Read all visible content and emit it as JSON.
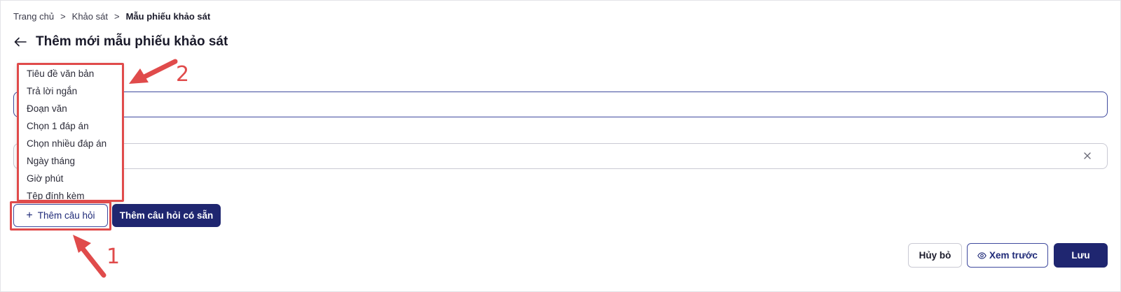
{
  "breadcrumb": {
    "items": [
      "Trang chủ",
      "Khảo sát",
      "Mẫu phiếu khảo sát"
    ],
    "separator": ">"
  },
  "page": {
    "title": "Thêm mới mẫu phiếu khảo sát"
  },
  "icons": {
    "back": "arrow-left-icon",
    "clear": "close-icon",
    "preview": "eye-icon",
    "add": "plus-icon"
  },
  "question_type_menu": {
    "options": [
      "Tiêu đề văn bản",
      "Trả lời ngắn",
      "Đoạn văn",
      "Chọn 1 đáp án",
      "Chọn nhiều đáp án",
      "Ngày tháng",
      "Giờ phút",
      "Tệp đính kèm"
    ]
  },
  "buttons": {
    "add_question": "Thêm câu hỏi",
    "add_existing_question": "Thêm câu hỏi có sẵn",
    "cancel": "Hủy bỏ",
    "preview": "Xem trước",
    "save": "Lưu"
  },
  "annotations": {
    "step_1": "1",
    "step_2": "2",
    "color": "#e04b4b"
  },
  "colors": {
    "primary": "#1f2670",
    "border_focus": "#3f4a9e"
  }
}
